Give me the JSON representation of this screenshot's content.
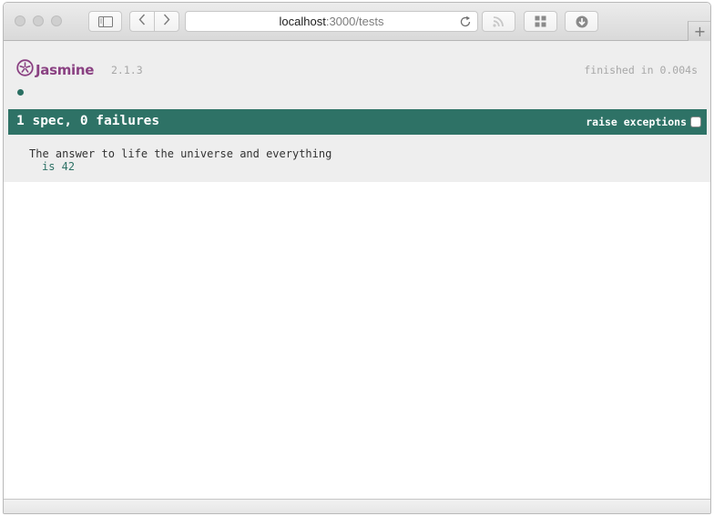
{
  "toolbar": {
    "address_host": "localhost",
    "address_path": ":3000/tests",
    "icons": [
      "sidebar-icon",
      "back-icon",
      "forward-icon",
      "reload-icon",
      "rss-icon",
      "grid-icon",
      "download-icon"
    ],
    "new_tab_label": "+"
  },
  "jasmine": {
    "logo_text": "Jasmine",
    "version": "2.1.3",
    "duration": "finished in 0.004s",
    "summary": "1 spec, 0 failures",
    "raise_exceptions_label": "raise exceptions",
    "raise_exceptions_checked": false,
    "suite_description": "The answer to life the universe and everything",
    "spec_description": "is 42"
  },
  "colors": {
    "passed": "#2e7266",
    "logo": "#8a4182",
    "page_background": "#eeeeee"
  }
}
